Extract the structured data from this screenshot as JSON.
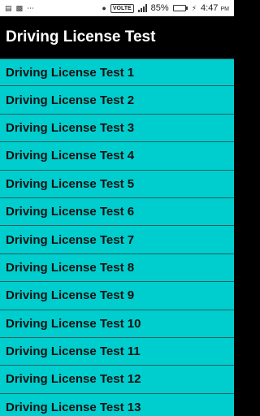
{
  "status_bar": {
    "battery_percent": "85%",
    "battery_level": 0.85,
    "time": "4:47",
    "ampm": "PM",
    "network_badge": "VOLTE",
    "icons": [
      "notification-icon",
      "image-icon",
      "more-icon",
      "location-icon",
      "volte-icon",
      "signal-icon",
      "battery-icon",
      "charging-icon"
    ]
  },
  "app_bar": {
    "title": "Driving License Test"
  },
  "tests": [
    {
      "label": "Driving License Test 1"
    },
    {
      "label": "Driving License Test 2"
    },
    {
      "label": "Driving License Test 3"
    },
    {
      "label": "Driving License Test 4"
    },
    {
      "label": "Driving License Test 5"
    },
    {
      "label": "Driving License Test 6"
    },
    {
      "label": "Driving License Test 7"
    },
    {
      "label": "Driving License Test 8"
    },
    {
      "label": "Driving License Test 9"
    },
    {
      "label": "Driving License Test 10"
    },
    {
      "label": "Driving License Test 11"
    },
    {
      "label": "Driving License Test 12"
    },
    {
      "label": "Driving License Test 13"
    }
  ],
  "colors": {
    "list_background": "#00cdcd",
    "app_bar_background": "#000000",
    "status_bar_background": "#ffffff"
  }
}
